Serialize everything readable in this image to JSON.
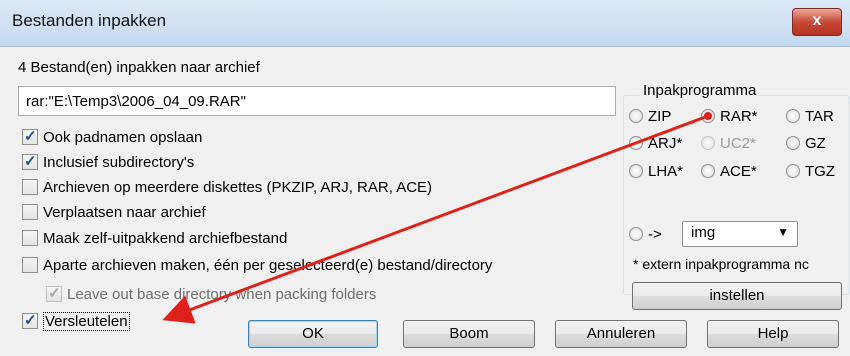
{
  "window": {
    "title": "Bestanden inpakken",
    "close_label": "x"
  },
  "summary_label": "4 Bestand(en) inpakken naar archief",
  "archive_field": {
    "value": "rar:\"E:\\Temp3\\2006_04_09.RAR\""
  },
  "options": [
    {
      "label": "Ook padnamen opslaan",
      "checked": true
    },
    {
      "label": "Inclusief subdirectory's",
      "checked": true
    },
    {
      "label": "Archieven op meerdere diskettes (PKZIP, ARJ, RAR, ACE)",
      "checked": false
    },
    {
      "label": "Verplaatsen naar archief",
      "checked": false
    },
    {
      "label": "Maak zelf-uitpakkend archiefbestand",
      "checked": false
    },
    {
      "label": "Aparte archieven maken, één per geselecteerd(e) bestand/directory",
      "checked": false
    },
    {
      "label": "Leave out base directory when packing folders",
      "checked": true,
      "disabled": true
    },
    {
      "label": "Versleutelen",
      "checked": true
    }
  ],
  "packer_group": {
    "title": "Inpakprogramma",
    "radios": {
      "zip": "ZIP",
      "rar": "RAR*",
      "tar": "TAR",
      "arj": "ARJ*",
      "uc2": "UC2*",
      "gz": "GZ",
      "lha": "LHA*",
      "ace": "ACE*",
      "tgz": "TGZ",
      "plugin": "->"
    },
    "selected": "RAR*",
    "plugin_select": "img",
    "note": "* extern inpakprogramma nc",
    "configure_button": "instellen"
  },
  "buttons": {
    "ok": "OK",
    "tree": "Boom",
    "cancel": "Annuleren",
    "help": "Help"
  },
  "annotation_color": "#e0201b"
}
